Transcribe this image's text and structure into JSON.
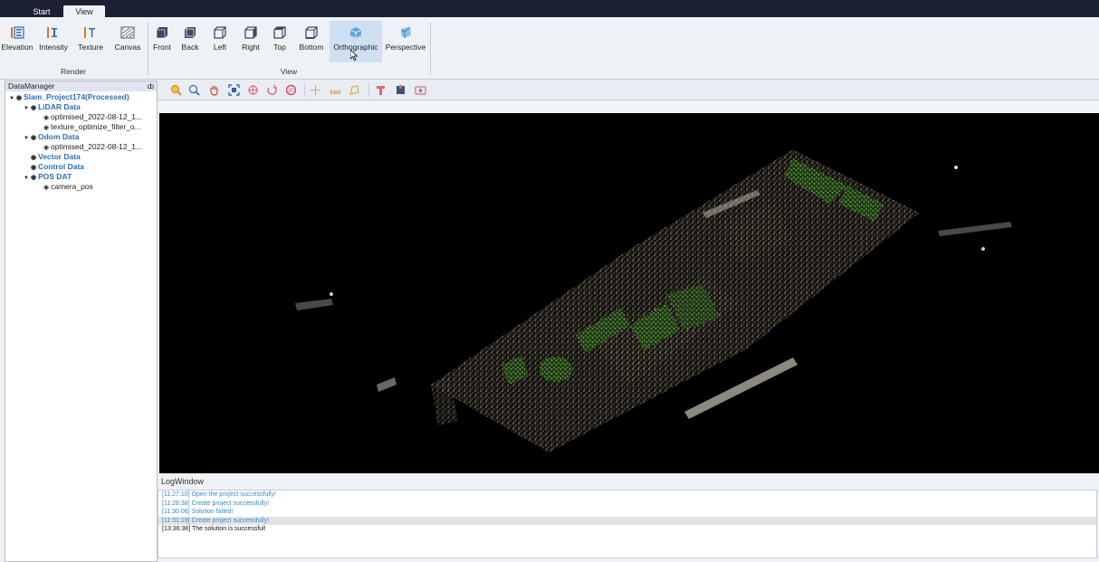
{
  "tabs": {
    "start": "Start",
    "view": "View"
  },
  "ribbon": {
    "render_buttons": [
      {
        "label": "Elevation",
        "icon": "elevation-icon"
      },
      {
        "label": "Intensity",
        "icon": "intensity-icon"
      },
      {
        "label": "Texture",
        "icon": "texture-icon"
      },
      {
        "label": "Canvas",
        "icon": "canvas-icon"
      }
    ],
    "render_group": "Render",
    "view_buttons": [
      {
        "label": "Front",
        "icon": "cube-front-icon"
      },
      {
        "label": "Back",
        "icon": "cube-back-icon"
      },
      {
        "label": "Left",
        "icon": "cube-left-icon"
      },
      {
        "label": "Right",
        "icon": "cube-right-icon"
      },
      {
        "label": "Top",
        "icon": "cube-top-icon"
      },
      {
        "label": "Bottom",
        "icon": "cube-bottom-icon"
      },
      {
        "label": "Orthographic",
        "icon": "orthographic-icon"
      },
      {
        "label": "Perspective",
        "icon": "perspective-icon"
      }
    ],
    "view_group": "View"
  },
  "data_manager": {
    "title": "DataManager",
    "pin": "ȸ",
    "root": "Slam_Project174(Processed)",
    "lidar": "LiDAR Data",
    "lidar_children": [
      "optimised_2022-08-12_1...",
      "texture_optimize_filter_o..."
    ],
    "odom": "Odom Data",
    "odom_children": [
      "optimised_2022-08-12_1..."
    ],
    "vector": "Vector Data",
    "control": "Control Data",
    "pos": "POS DAT",
    "pos_children": [
      "camera_pos"
    ]
  },
  "log_window": {
    "title": "LogWindow",
    "lines": [
      "[11:27:10] Open the project successfully!",
      "[11:28:38] Create project successfully!",
      "[11:30:06] Solution failed!",
      "[11:31:19] Create project successfully!",
      "[13:36:38] The solution is successful!"
    ]
  },
  "colors": {
    "accent": "#2e6fb4",
    "log_text": "#3b88c6",
    "dark_bar": "#1b2132"
  }
}
